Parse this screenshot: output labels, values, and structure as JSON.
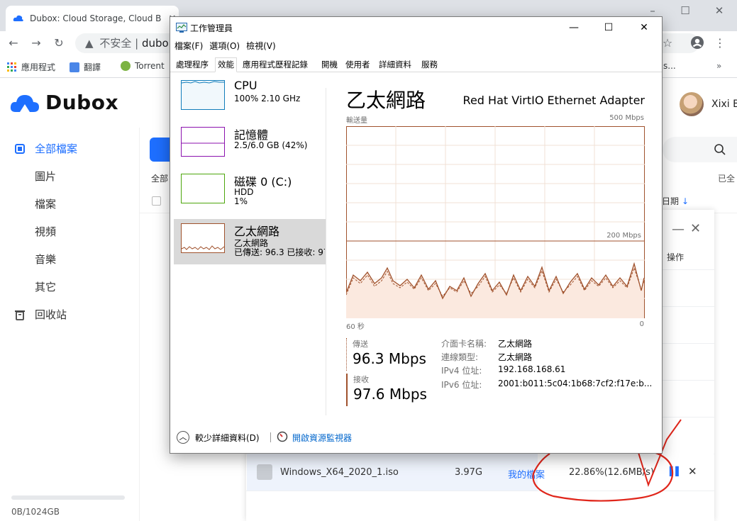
{
  "browser": {
    "tab_title": "Dubox: Cloud Storage, Cloud B",
    "security_label": "不安全",
    "url": "dubo",
    "bookmarks": [
      {
        "label": "應用程式"
      },
      {
        "label": "翻譯"
      },
      {
        "label": "Torrent"
      }
    ],
    "bookmarks_overflow": "s..."
  },
  "dubox": {
    "logo_text": "Dubox",
    "sidebar": [
      {
        "label": "全部檔案"
      },
      {
        "label": "圖片"
      },
      {
        "label": "檔案"
      },
      {
        "label": "視頻"
      },
      {
        "label": "音樂"
      },
      {
        "label": "其它"
      },
      {
        "label": "回收站"
      }
    ],
    "storage_used_fraction": 0.0,
    "storage_text": "0B/1024GB",
    "username": "Xixi B",
    "all_label": "全部",
    "selected_all": "已全",
    "date_sort": "日期",
    "transfer": {
      "operation_header": "操作",
      "file_name": "Windows_X64_2020_1.iso",
      "file_size": "3.97G",
      "destination": "我的檔案",
      "progress": "22.86%(12.6MB/s)"
    }
  },
  "task_manager": {
    "title": "工作管理員",
    "menu": [
      "檔案(F)",
      "選項(O)",
      "檢視(V)"
    ],
    "tabs": [
      "處理程序",
      "效能",
      "應用程式歷程記錄",
      "開機",
      "使用者",
      "詳細資料",
      "服務"
    ],
    "active_tab": "效能",
    "perf_items": [
      {
        "name": "CPU",
        "line1": "100% 2.10 GHz",
        "line2": ""
      },
      {
        "name": "記憶體",
        "line1": "2.5/6.0 GB (42%)",
        "line2": ""
      },
      {
        "name": "磁碟 0 (C:)",
        "line1": "HDD",
        "line2": "1%"
      },
      {
        "name": "乙太網路",
        "line1": "乙太網路",
        "line2": "已傳送: 96.3 已接收: 97"
      }
    ],
    "ethernet": {
      "title": "乙太網路",
      "adapter": "Red Hat VirtIO Ethernet Adapter",
      "y_label": "輸送量",
      "y_max": "500 Mbps",
      "y_mid": "200 Mbps",
      "x_left": "60 秒",
      "x_right": "0",
      "send_label": "傳送",
      "send_value": "96.3 Mbps",
      "recv_label": "接收",
      "recv_value": "97.6 Mbps",
      "info": [
        {
          "key": "介面卡名稱:",
          "value": "乙太網路"
        },
        {
          "key": "連線類型:",
          "value": "乙太網路"
        },
        {
          "key": "IPv4 位址:",
          "value": "192.168.168.61"
        },
        {
          "key": "IPv6 位址:",
          "value": "2001:b011:5c04:1b68:7cf2:f17e:b..."
        }
      ]
    },
    "fewer_details": "較少詳細資料(D)",
    "resource_monitor": "開啟資源監視器"
  },
  "colors": {
    "dubox_blue": "#1e6fff",
    "eth_line": "#a0522d",
    "annotation_red": "#e0261b"
  }
}
